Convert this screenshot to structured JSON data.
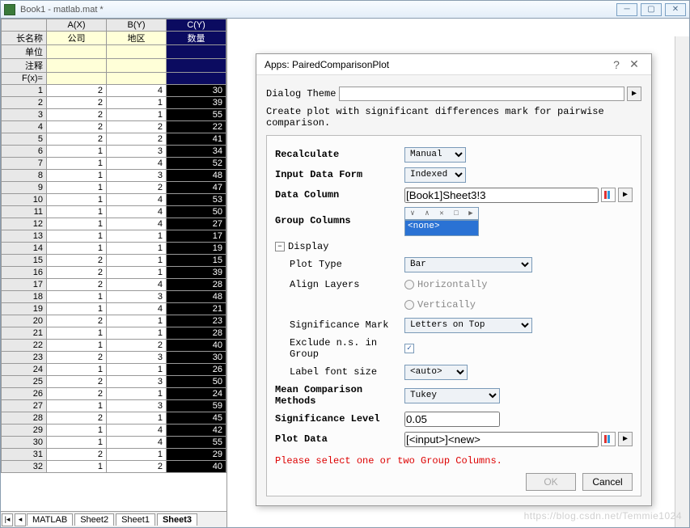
{
  "titlebar": {
    "title": "Book1 - matlab.mat *"
  },
  "winbtns": {
    "min": "─",
    "max": "▢",
    "close": "✕"
  },
  "sheet": {
    "headers": {
      "corner": "",
      "a": "A(X)",
      "b": "B(Y)",
      "c": "C(Y)"
    },
    "meta": [
      {
        "label": "长名称",
        "a": "公司",
        "b": "地区",
        "c": "数量"
      },
      {
        "label": "单位",
        "a": "",
        "b": "",
        "c": ""
      },
      {
        "label": "注释",
        "a": "",
        "b": "",
        "c": ""
      },
      {
        "label": "F(x)=",
        "a": "",
        "b": "",
        "c": ""
      }
    ],
    "rows": [
      {
        "n": 1,
        "a": 2,
        "b": 4,
        "c": 30
      },
      {
        "n": 2,
        "a": 2,
        "b": 1,
        "c": 39
      },
      {
        "n": 3,
        "a": 2,
        "b": 1,
        "c": 55
      },
      {
        "n": 4,
        "a": 2,
        "b": 2,
        "c": 22
      },
      {
        "n": 5,
        "a": 2,
        "b": 2,
        "c": 41
      },
      {
        "n": 6,
        "a": 1,
        "b": 3,
        "c": 34
      },
      {
        "n": 7,
        "a": 1,
        "b": 4,
        "c": 52
      },
      {
        "n": 8,
        "a": 1,
        "b": 3,
        "c": 48
      },
      {
        "n": 9,
        "a": 1,
        "b": 2,
        "c": 47
      },
      {
        "n": 10,
        "a": 1,
        "b": 4,
        "c": 53
      },
      {
        "n": 11,
        "a": 1,
        "b": 4,
        "c": 50
      },
      {
        "n": 12,
        "a": 1,
        "b": 4,
        "c": 27
      },
      {
        "n": 13,
        "a": 1,
        "b": 1,
        "c": 17
      },
      {
        "n": 14,
        "a": 1,
        "b": 1,
        "c": 19
      },
      {
        "n": 15,
        "a": 2,
        "b": 1,
        "c": 15
      },
      {
        "n": 16,
        "a": 2,
        "b": 1,
        "c": 39
      },
      {
        "n": 17,
        "a": 2,
        "b": 4,
        "c": 28
      },
      {
        "n": 18,
        "a": 1,
        "b": 3,
        "c": 48
      },
      {
        "n": 19,
        "a": 1,
        "b": 4,
        "c": 21
      },
      {
        "n": 20,
        "a": 2,
        "b": 1,
        "c": 23
      },
      {
        "n": 21,
        "a": 1,
        "b": 1,
        "c": 28
      },
      {
        "n": 22,
        "a": 1,
        "b": 2,
        "c": 40
      },
      {
        "n": 23,
        "a": 2,
        "b": 3,
        "c": 30
      },
      {
        "n": 24,
        "a": 1,
        "b": 1,
        "c": 26
      },
      {
        "n": 25,
        "a": 2,
        "b": 3,
        "c": 50
      },
      {
        "n": 26,
        "a": 2,
        "b": 1,
        "c": 24
      },
      {
        "n": 27,
        "a": 1,
        "b": 3,
        "c": 59
      },
      {
        "n": 28,
        "a": 2,
        "b": 1,
        "c": 45
      },
      {
        "n": 29,
        "a": 1,
        "b": 4,
        "c": 42
      },
      {
        "n": 30,
        "a": 1,
        "b": 4,
        "c": 55
      },
      {
        "n": 31,
        "a": 2,
        "b": 1,
        "c": 29
      },
      {
        "n": 32,
        "a": 1,
        "b": 2,
        "c": 40
      }
    ],
    "tabs": [
      "MATLAB",
      "Sheet2",
      "Sheet1",
      "Sheet3"
    ],
    "active_tab": 3
  },
  "dialog": {
    "title": "Apps: PairedComparisonPlot",
    "theme_label": "Dialog Theme",
    "desc": "Create plot with significant differences mark for pairwise comparison.",
    "recalc_label": "Recalculate",
    "recalc_value": "Manual",
    "inputform_label": "Input Data Form",
    "inputform_value": "Indexed",
    "datacol_label": "Data Column",
    "datacol_value": "[Book1]Sheet3!3",
    "groupcol_label": "Group Columns",
    "groupcol_value": "<none>",
    "display_label": "Display",
    "plottype_label": "Plot Type",
    "plottype_value": "Bar",
    "align_label": "Align Layers",
    "align_h": "Horizontally",
    "align_v": "Vertically",
    "sigmark_label": "Significance Mark",
    "sigmark_value": "Letters on Top",
    "exclude_label": "Exclude n.s. in Group",
    "font_label": "Label font size",
    "font_value": "<auto>",
    "method_label": "Mean Comparison Methods",
    "method_value": "Tukey",
    "siglvl_label": "Significance Level",
    "siglvl_value": "0.05",
    "plotdata_label": "Plot Data",
    "plotdata_value": "[<input>]<new>",
    "error": "Please select one or two Group Columns.",
    "ok": "OK",
    "cancel": "Cancel"
  },
  "watermark": "https://blog.csdn.net/Temmie1024"
}
